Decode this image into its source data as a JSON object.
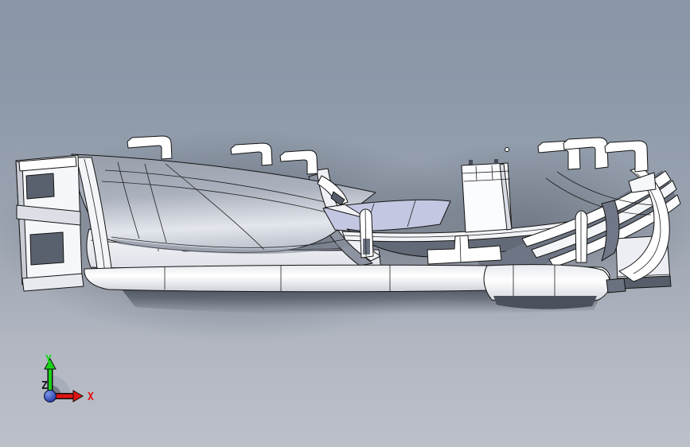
{
  "scene": {
    "background_top": "#8a96a7",
    "background_bottom": "#bcc0c8",
    "model_body_color": "#ffffff",
    "model_edge_color": "#141414",
    "deck_top_color": "#969da9",
    "deck_bottom_color": "#e3e6ec",
    "accent_lavender": "#c3c7e1",
    "cavity_color": "#636a77",
    "underside_color": "#49515e"
  },
  "triad": {
    "x_label": "X",
    "y_label": "Y",
    "z_label": "Z",
    "x_color": "#e01313",
    "y_color": "#1ad41a",
    "z_color": "#15151d",
    "origin_sphere_color": "#2440c0",
    "sector_color": "#a7adb8"
  }
}
